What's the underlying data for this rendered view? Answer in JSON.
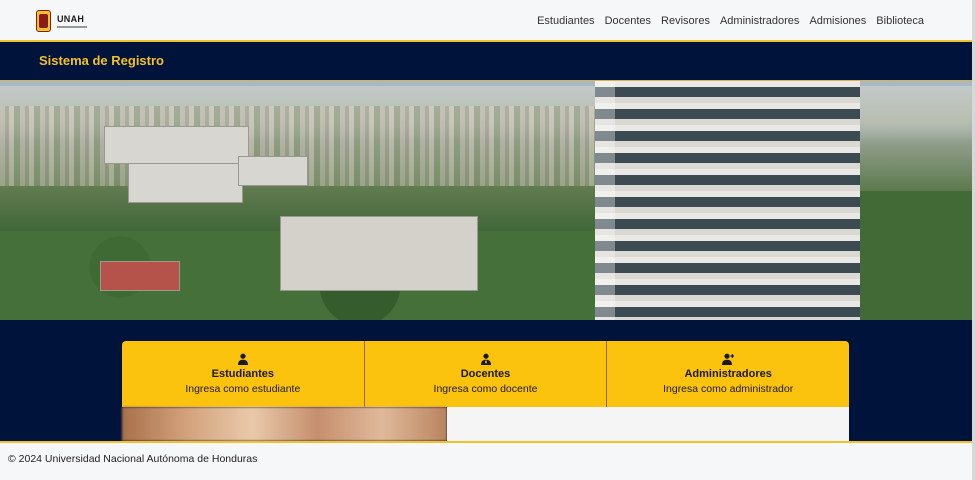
{
  "brand": {
    "logo_text": "UNAH"
  },
  "nav": {
    "items": [
      "Estudiantes",
      "Docentes",
      "Revisores",
      "Administradores",
      "Admisiones",
      "Biblioteca"
    ]
  },
  "title": "Sistema de Registro",
  "cards": [
    {
      "icon": "user-icon",
      "title": "Estudiantes",
      "desc": "Ingresa como estudiante"
    },
    {
      "icon": "teacher-icon",
      "title": "Docentes",
      "desc": "Ingresa como docente"
    },
    {
      "icon": "user-plus-icon",
      "title": "Administradores",
      "desc": "Ingresa como administrador"
    }
  ],
  "footer": {
    "text": "© 2024 Universidad Nacional Autónoma de Honduras"
  },
  "colors": {
    "navy": "#00133a",
    "gold": "#fbc20e",
    "title_gold": "#f3c12a"
  }
}
